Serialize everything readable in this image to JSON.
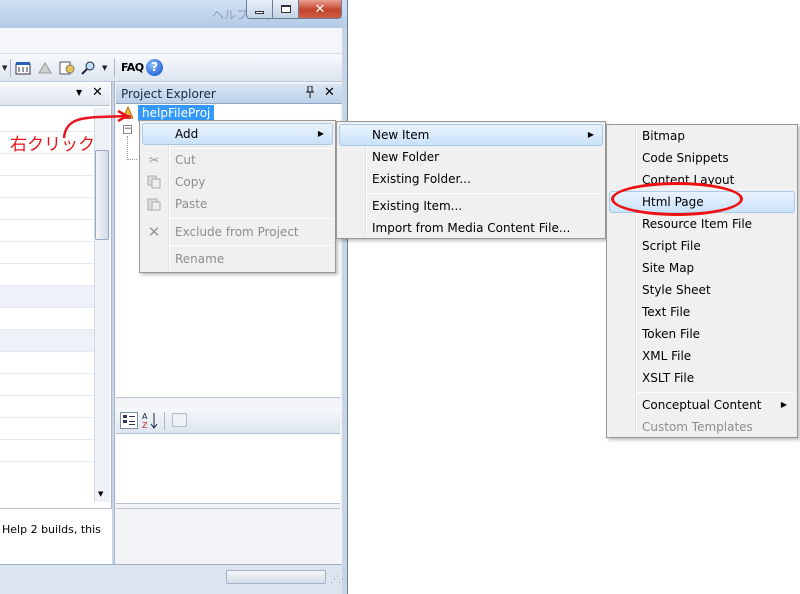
{
  "window": {
    "title": "ヘルプ ファイル"
  },
  "toolbar": {
    "faq_label": "FAQ",
    "help_icon_glyph": "?"
  },
  "left_pane": {
    "status_text": "Help 2 builds, this"
  },
  "project_explorer": {
    "title": "Project Explorer",
    "pin_glyph": "📌",
    "close_glyph": "✕",
    "project_node": "helpFileProj"
  },
  "annotation": {
    "label": "右クリック",
    "color": "#e8141e"
  },
  "context_menu": {
    "add": "Add",
    "cut": "Cut",
    "copy": "Copy",
    "paste": "Paste",
    "exclude": "Exclude from Project",
    "rename": "Rename"
  },
  "add_menu": {
    "new_item": "New Item",
    "new_folder": "New Folder",
    "existing_folder": "Existing Folder...",
    "existing_item": "Existing Item...",
    "import_media": "Import from Media Content File..."
  },
  "new_item_menu": {
    "items": [
      "Bitmap",
      "Code Snippets",
      "Content Layout",
      "Html Page",
      "Resource Item File",
      "Script File",
      "Site Map",
      "Style Sheet",
      "Text File",
      "Token File",
      "XML File",
      "XSLT File"
    ],
    "conceptual": "Conceptual Content",
    "custom_templates": "Custom Templates"
  },
  "colors": {
    "selection": "#3399ff",
    "highlight_circle": "#ee1111"
  }
}
